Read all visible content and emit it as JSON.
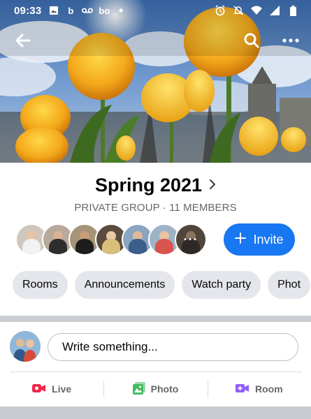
{
  "status_bar": {
    "time": "09:33",
    "left_icons": [
      "image-icon",
      "b-app-icon",
      "voicemail-icon",
      "bo-app-icon",
      "dot-icon"
    ],
    "right_icons": [
      "alarm-icon",
      "notifications-off-icon",
      "wifi-icon",
      "signal-icon",
      "battery-icon"
    ]
  },
  "top_bar": {
    "back_icon": "arrow-left-icon",
    "search_icon": "search-icon",
    "more_icon": "more-horizontal-icon"
  },
  "group": {
    "name": "Spring 2021",
    "meta": "PRIVATE GROUP · 11 MEMBERS",
    "members_more_label": "···"
  },
  "invite": {
    "label": "Invite",
    "icon": "plus-icon",
    "color": "#1877f2"
  },
  "tabs": [
    "Rooms",
    "Announcements",
    "Watch party",
    "Phot"
  ],
  "composer": {
    "placeholder": "Write something..."
  },
  "actions": [
    {
      "label": "Live",
      "icon": "live-video-icon",
      "color": "#f02849"
    },
    {
      "label": "Photo",
      "icon": "photo-icon",
      "color": "#45bd62"
    },
    {
      "label": "Room",
      "icon": "room-video-icon",
      "color": "#9360f7"
    }
  ]
}
